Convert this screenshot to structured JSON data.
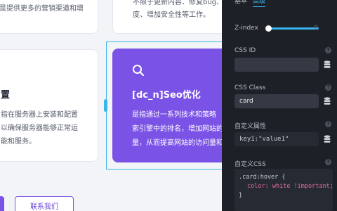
{
  "cards": {
    "top_left_line": "是提供更多的营销渠道和增",
    "top_right_lines": [
      "不限于更新内容、修复bug、",
      "度、增加安全性等工作。"
    ],
    "mid_left_title": "置",
    "mid_left_lines": [
      "指在服务器上安装和配置",
      "以确保服务器能够正常运",
      "能和服务。"
    ],
    "seo_title": "[dc_n]Seo优化",
    "seo_lines": [
      "是指通过一系列技术和策略",
      "索引擎中的排名，增加网站的",
      "量，从而提高网站的访问量和"
    ]
  },
  "buttons": {
    "contact": "联系我们"
  },
  "panel": {
    "tabs": [
      "基本",
      "高级"
    ],
    "zindex_label": "Z-index",
    "zindex_value": "0",
    "css_id_label": "CSS ID",
    "css_id_value": "",
    "css_class_label": "CSS Class",
    "css_class_value": "card",
    "custom_attr_label": "自定义属性",
    "custom_attr_value": "key1:\"value1\"",
    "custom_css_label": "自定义CSS",
    "css_code": {
      "selector": ".card:hover",
      "brace_open": "{",
      "prop": "color:",
      "val": "white !important;",
      "brace_close": "}"
    }
  },
  "colors": {
    "accent": "#39b4f0",
    "brand_purple": "#7a52e6",
    "panel_bg": "#1d2027"
  },
  "icons": [
    "search-icon",
    "help-icon",
    "database-icon"
  ]
}
